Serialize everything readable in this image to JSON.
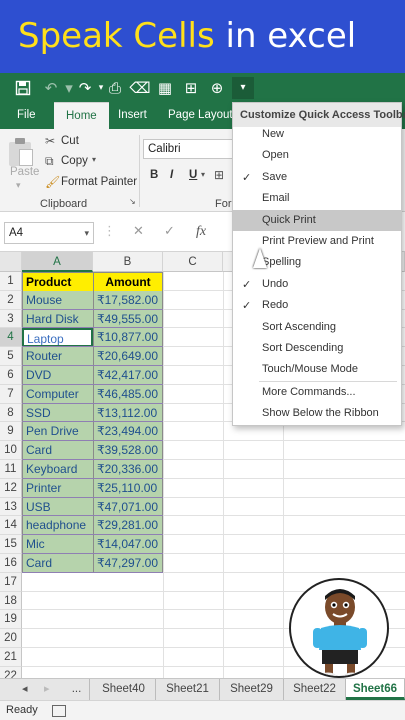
{
  "banner": {
    "title_part1": "Speak Cells",
    "title_part2": " in excel"
  },
  "qat": {
    "icons": [
      "save-icon",
      "undo-icon",
      "redo-icon",
      "quick-print-icon",
      "clear-format-icon",
      "freeze-panes-icon",
      "merge-icon",
      "insert-icon",
      "customize-dropdown-icon"
    ]
  },
  "tabs": [
    "File",
    "Home",
    "Insert",
    "Page Layout"
  ],
  "ribbon": {
    "paste": "Paste",
    "cut": "Cut",
    "copy": "Copy",
    "format_painter": "Format Painter",
    "clipboard_group": "Clipboard",
    "font_name": "Calibri",
    "bold": "B",
    "italic": "I",
    "underline": "U",
    "font_group_partial": "For"
  },
  "formula_bar": {
    "name_box": "A4",
    "fx": "fx"
  },
  "columns": [
    "A",
    "B",
    "C"
  ],
  "rows": [
    "1",
    "2",
    "3",
    "4",
    "5",
    "6",
    "7",
    "8",
    "9",
    "10",
    "11",
    "12",
    "13",
    "14",
    "15",
    "16",
    "17",
    "18",
    "19",
    "20",
    "21",
    "22"
  ],
  "table": {
    "header": [
      "Product",
      "Amount"
    ],
    "rows": [
      [
        "Mouse",
        "₹17,582.00"
      ],
      [
        "Hard Disk",
        "₹49,555.00"
      ],
      [
        "Laptop",
        "₹10,877.00"
      ],
      [
        "Router",
        "₹20,649.00"
      ],
      [
        "DVD",
        "₹42,417.00"
      ],
      [
        "Computer",
        "₹46,485.00"
      ],
      [
        "SSD",
        "₹13,112.00"
      ],
      [
        "Pen Drive",
        "₹23,494.00"
      ],
      [
        "Card",
        "₹39,528.00"
      ],
      [
        "Keyboard",
        "₹20,336.00"
      ],
      [
        "Printer",
        "₹25,110.00"
      ],
      [
        "USB",
        "₹47,071.00"
      ],
      [
        "headphone",
        "₹29,281.00"
      ],
      [
        "Mic",
        "₹14,047.00"
      ],
      [
        "Card",
        "₹47,297.00"
      ]
    ]
  },
  "menu": {
    "header": "Customize Quick Access Toolbar",
    "items": [
      {
        "label": "New",
        "checked": false
      },
      {
        "label": "Open",
        "checked": false
      },
      {
        "label": "Save",
        "checked": true
      },
      {
        "label": "Email",
        "checked": false
      },
      {
        "label": "Quick Print",
        "checked": false,
        "highlighted": true
      },
      {
        "label": "Print Preview and Print",
        "checked": false
      },
      {
        "label": "Spelling",
        "checked": false
      },
      {
        "label": "Undo",
        "checked": true
      },
      {
        "label": "Redo",
        "checked": true
      },
      {
        "label": "Sort Ascending",
        "checked": false
      },
      {
        "label": "Sort Descending",
        "checked": false
      },
      {
        "label": "Touch/Mouse Mode",
        "checked": false
      },
      {
        "label": "More Commands...",
        "checked": false
      },
      {
        "label": "Show Below the Ribbon",
        "checked": false
      }
    ],
    "checkmark": "✓"
  },
  "sheets": {
    "ellipsis": "...",
    "tabs": [
      "Sheet40",
      "Sheet21",
      "Sheet29",
      "Sheet22",
      "Sheet66"
    ],
    "active": "Sheet66"
  },
  "status": {
    "ready": "Ready"
  },
  "colors": {
    "excel_green": "#217346",
    "banner_blue": "#2e4fd0",
    "banner_yellow": "#ffe01a",
    "header_yellow": "#ffee00",
    "data_fill": "#b6d3ac",
    "data_text": "#20508e"
  }
}
